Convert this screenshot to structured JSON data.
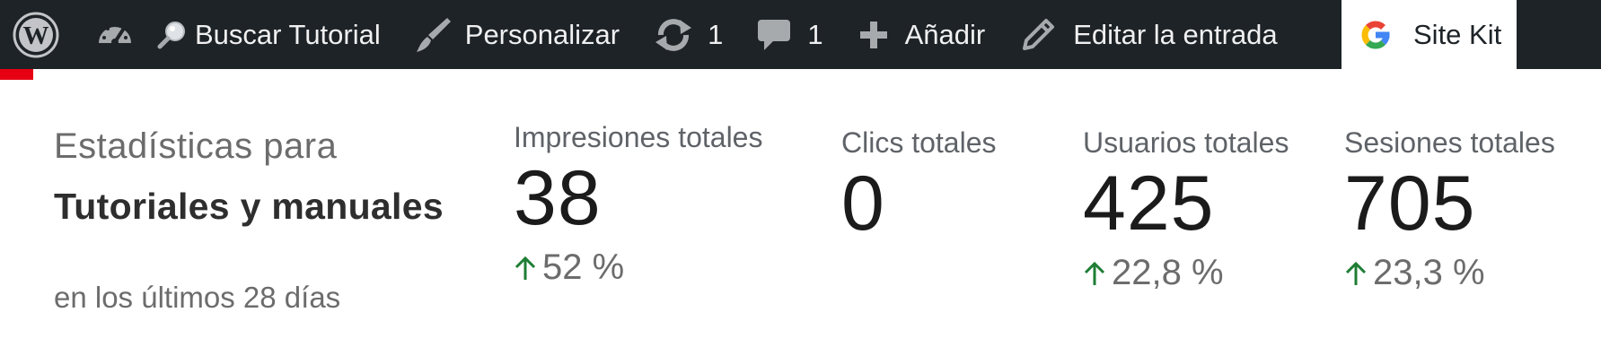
{
  "adminbar": {
    "search_label": "Buscar Tutorial",
    "customize_label": "Personalizar",
    "updates_count": "1",
    "comments_count": "1",
    "add_label": "Añadir",
    "edit_label": "Editar la entrada",
    "sitekit_label": "Site Kit"
  },
  "stats": {
    "intro_prefix": "Estadísticas para",
    "site_name": "Tutoriales y manuales",
    "date_range": "en los últimos 28 días",
    "metrics": [
      {
        "label": "Impresiones totales",
        "value": "38",
        "change": "52 %",
        "trend": "up"
      },
      {
        "label": "Clics totales",
        "value": "0",
        "change": "",
        "trend": ""
      },
      {
        "label": "Usuarios totales",
        "value": "425",
        "change": "22,8 %",
        "trend": "up"
      },
      {
        "label": "Sesiones totales",
        "value": "705",
        "change": "23,3 %",
        "trend": "up"
      }
    ]
  },
  "colors": {
    "adminbar_bg": "#1d2327",
    "accent_red": "#e60012",
    "trend_up": "#1e7d34"
  }
}
